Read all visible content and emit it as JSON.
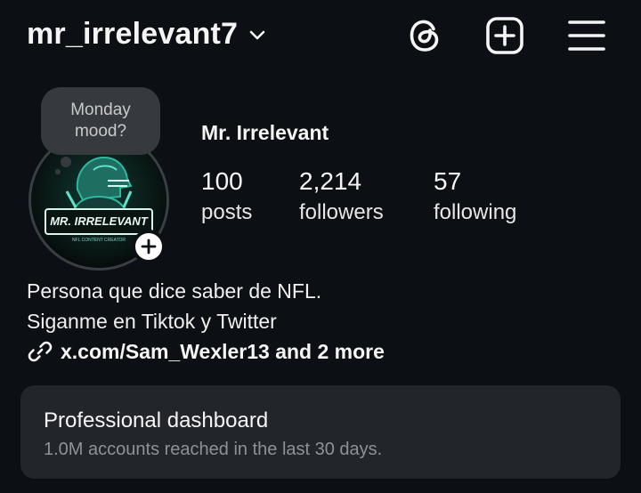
{
  "header": {
    "username": "mr_irrelevant7",
    "icons": [
      "chevron-down-icon",
      "threads-icon",
      "new-post-icon",
      "menu-icon"
    ]
  },
  "profile": {
    "note": [
      "Monday",
      "mood?"
    ],
    "display_name": "Mr. Irrelevant",
    "avatar_text": "MR. IRRELEVANT",
    "avatar_subtext": "NFL CONTENT CREATOR",
    "stats": [
      {
        "value": "100",
        "label": "posts"
      },
      {
        "value": "2,214",
        "label": "followers"
      },
      {
        "value": "57",
        "label": "following"
      }
    ],
    "bio": [
      "Persona que dice saber de NFL.",
      "Siganme en Tiktok y Twitter"
    ],
    "link": "x.com/Sam_Wexler13 and 2 more"
  },
  "dashboard": {
    "title": "Professional dashboard",
    "subtitle": "1.0M accounts reached in the last 30 days."
  },
  "colors": {
    "background": "#0c1014",
    "card": "#22262b",
    "note_bubble": "#363a3f",
    "avatar_accent": "#2fb8a0"
  }
}
